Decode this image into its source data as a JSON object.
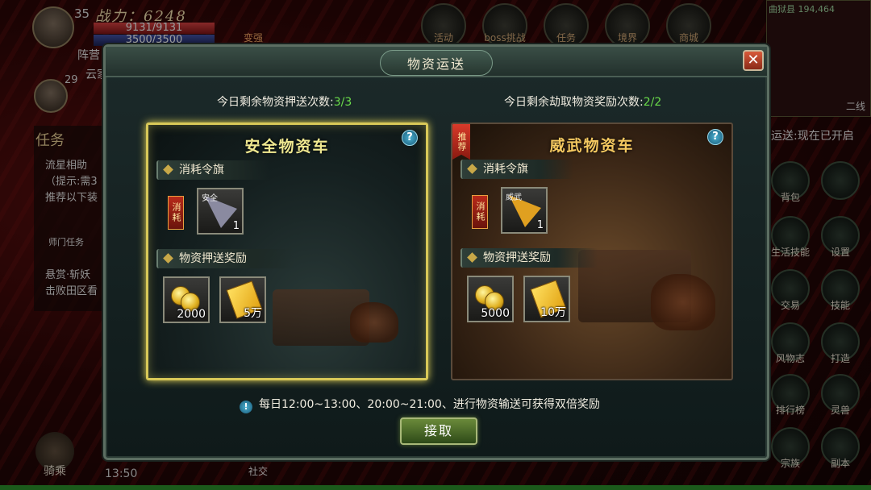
{
  "hud": {
    "player_level": "35",
    "power_label": "战力：6248",
    "hp_text": "9131/9131",
    "mp_text": "3500/3500",
    "faction_label": "阵营",
    "ally_level": "29",
    "ally_name": "云家",
    "upgrade_label": "变强",
    "top_menu": [
      "活动",
      "boss挑战",
      "任务",
      "境界",
      "商城"
    ],
    "minimap_title": "曲狱县 194,464",
    "minimap_line": "二线",
    "task_title": "任务",
    "task_lines": [
      "流星相助",
      "（提示:需3",
      "推荐以下装",
      "师门任务",
      "悬赏·斩妖",
      "击败田区看"
    ],
    "transport_status": "运送:现在已开启",
    "right_menu": [
      "背包",
      "",
      "生活技能",
      "设置",
      "交易",
      "技能",
      "风物志",
      "打造",
      "排行榜",
      "灵兽",
      "宗族",
      "副本"
    ],
    "mount_label": "骑乘",
    "time": "13:50",
    "social_label": "社交"
  },
  "modal": {
    "title": "物资运送",
    "close_icon": "close-icon",
    "escort_count_label": "今日剩余物资押送次数:",
    "escort_count_value": "3/3",
    "rob_count_label": "今日剩余劫取物资奖励次数:",
    "rob_count_value": "2/2",
    "cards": [
      {
        "title": "安全物资车",
        "recommended": false,
        "cost_section": "消耗令旗",
        "consume_tag": "消耗",
        "flag_name": "安全",
        "flag_count": "1",
        "flag_color": "#8a8aa0",
        "reward_section": "物资押送奖励",
        "rewards": [
          {
            "icon": "coin-icon",
            "amount": "2000"
          },
          {
            "icon": "ticket-icon",
            "amount": "5万"
          }
        ]
      },
      {
        "title": "威武物资车",
        "recommended": true,
        "recommend_label": "推荐",
        "cost_section": "消耗令旗",
        "consume_tag": "消耗",
        "flag_name": "威武",
        "flag_count": "1",
        "flag_color": "#e0a020",
        "reward_section": "物资押送奖励",
        "rewards": [
          {
            "icon": "coin-icon",
            "amount": "5000"
          },
          {
            "icon": "ticket-icon",
            "amount": "10万"
          }
        ]
      }
    ],
    "notice": "每日12:00~13:00、20:00~21:00、进行物资输送可获得双倍奖励",
    "accept_label": "接取"
  },
  "colors": {
    "accent_green": "#6adc4a",
    "selected_border": "#d8c858"
  }
}
